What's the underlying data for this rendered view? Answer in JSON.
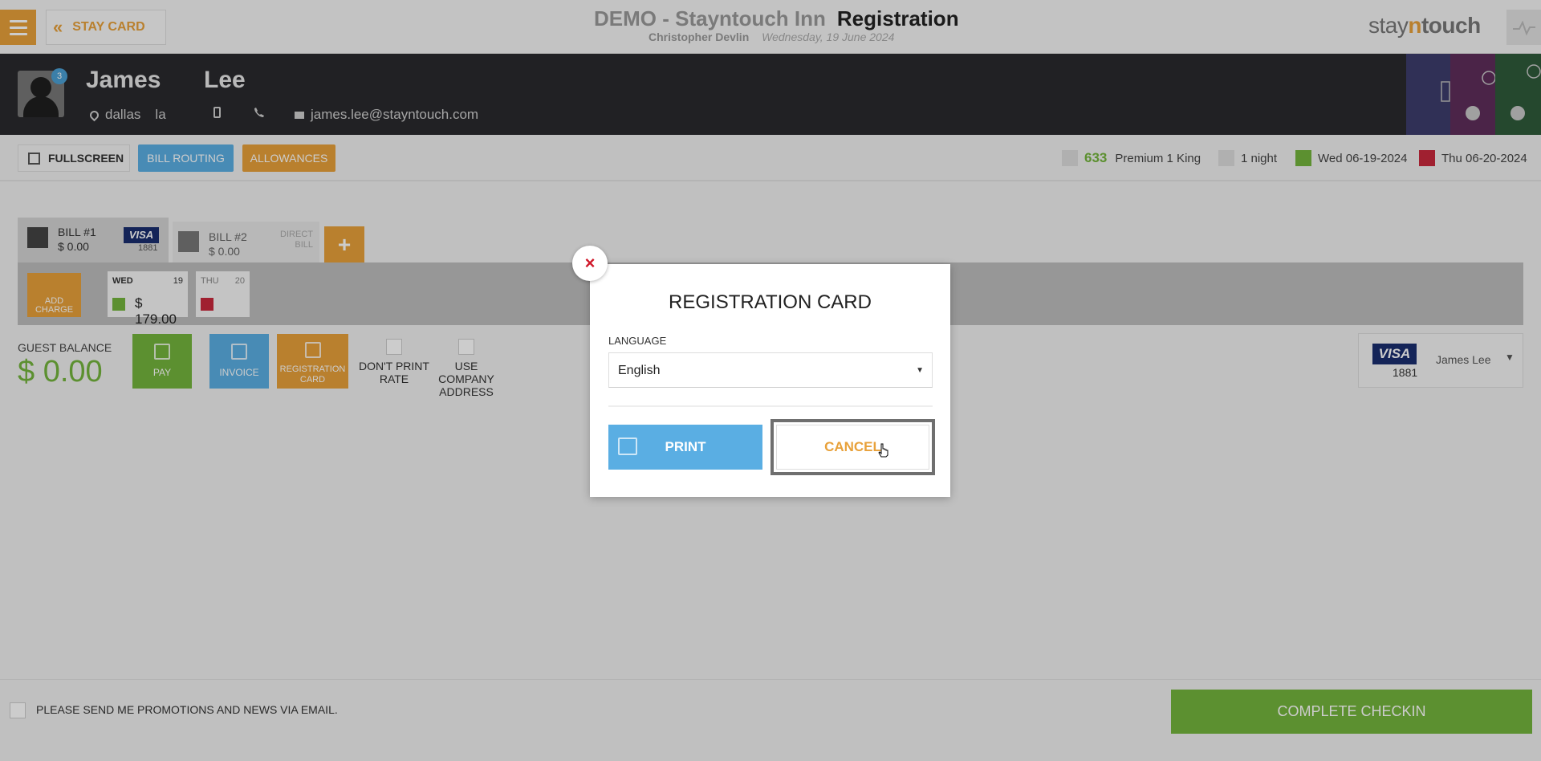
{
  "header": {
    "stay_card_label": "STAY CARD",
    "hotel_name": "DEMO - Stayntouch Inn",
    "page_title": "Registration",
    "user_name": "Christopher Devlin",
    "date": "Wednesday, 19 June 2024",
    "logo_pre": "stay",
    "logo_n": "n",
    "logo_post": "touch"
  },
  "guest": {
    "first_name": "James",
    "last_name": "Lee",
    "city": "dallas",
    "state": "la",
    "email": "james.lee@stayntouch.com",
    "badge": "3"
  },
  "reservation_bar": {
    "fullscreen_label": "FULLSCREEN",
    "bill_routing_label": "BILL ROUTING",
    "allowances_label": "ALLOWANCES",
    "room_number": "633",
    "room_type": "Premium 1 King",
    "nights": "1 night",
    "arrival": "Wed 06-19-2024",
    "departure": "Thu 06-20-2024"
  },
  "bills": [
    {
      "label": "BILL #1",
      "amount": "$ 0.00",
      "card": "VISA",
      "card_last4": "1881"
    },
    {
      "label": "BILL #2",
      "amount": "$ 0.00",
      "payment": "DIRECT\nBILL"
    }
  ],
  "add_bill_label": "+",
  "add_charge_label": "ADD CHARGE",
  "days": [
    {
      "name": "WED",
      "num": "19",
      "amount": "$ 179.00"
    },
    {
      "name": "THU",
      "num": "20",
      "amount": ""
    }
  ],
  "balance": {
    "label": "GUEST BALANCE",
    "amount": "$ 0.00"
  },
  "actions": {
    "pay": "PAY",
    "invoice": "INVOICE",
    "registration_card": "REGISTRATION CARD",
    "dont_print_rate": "DON'T PRINT RATE",
    "use_company_address": "USE COMPANY ADDRESS"
  },
  "card_selector": {
    "card": "VISA",
    "last4": "1881",
    "name": "James Lee"
  },
  "footer": {
    "promo_label": "PLEASE SEND ME PROMOTIONS AND NEWS VIA EMAIL.",
    "complete_checkin": "COMPLETE CHECKIN"
  },
  "modal": {
    "title": "REGISTRATION CARD",
    "language_label": "LANGUAGE",
    "language_value": "English",
    "print_label": "PRINT",
    "cancel_label": "CANCEL",
    "close_icon": "×"
  },
  "colors": {
    "accent_orange": "#e8a13a",
    "accent_blue": "#5aaee3",
    "accent_green": "#73b43c",
    "danger_red": "#d0192b",
    "guest_bar": "#2a2a2e"
  }
}
